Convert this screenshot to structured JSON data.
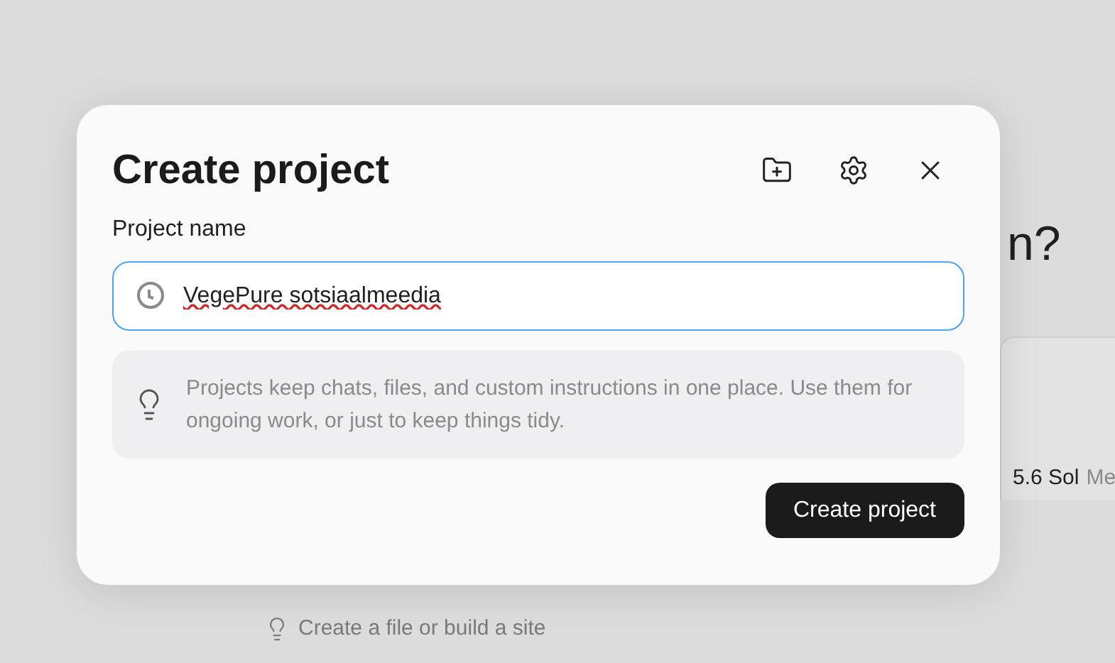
{
  "background": {
    "heading": "n?",
    "card": {
      "model": "5.6 Sol",
      "suffix": "Me"
    },
    "suggestion": "Create a file or build a site"
  },
  "dialog": {
    "title": "Create project",
    "field_label": "Project name",
    "name_value": "VegePure sotsiaalmeedia",
    "info": "Projects keep chats, files, and custom instructions in one place. Use them for ongoing work, or just to keep things tidy.",
    "submit": "Create project"
  }
}
